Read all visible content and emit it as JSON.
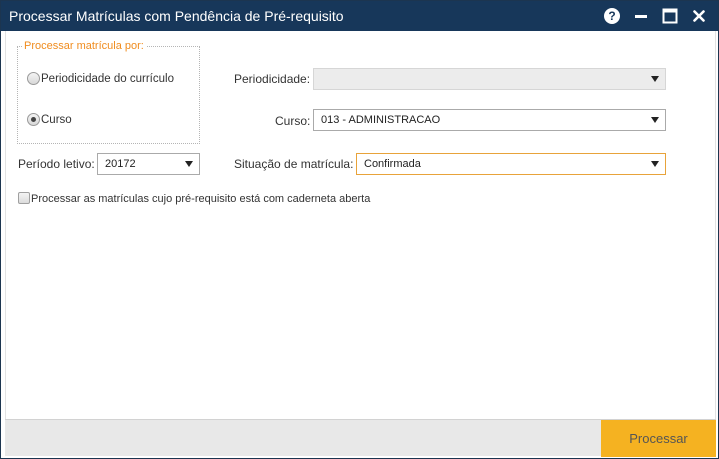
{
  "window": {
    "title": "Processar Matrículas com Pendência de Pré-requisito",
    "help_icon": "help-icon",
    "minimize_icon": "minimize-icon",
    "maximize_icon": "maximize-icon",
    "close_icon": "close-icon",
    "title_bar_color": "#17375a"
  },
  "group": {
    "legend": "Processar matrícula por:",
    "legend_color": "#f08c1e",
    "options": [
      {
        "label": "Periodicidade do currículo",
        "selected": false
      },
      {
        "label": "Curso",
        "selected": true
      }
    ]
  },
  "fields": {
    "periodicidade": {
      "label": "Periodicidade:",
      "value": "",
      "disabled": true
    },
    "curso": {
      "label": "Curso:",
      "value": "013 - ADMINISTRACAO"
    },
    "periodo_letivo": {
      "label": "Período letivo:",
      "value": "20172"
    },
    "situacao": {
      "label": "Situação de matrícula:",
      "value": "Confirmada"
    }
  },
  "checkbox": {
    "label": "Processar as matrículas cujo pré-requisito está com caderneta aberta",
    "checked": false
  },
  "footer": {
    "primary_label": "Processar",
    "primary_color": "#f5b221"
  }
}
